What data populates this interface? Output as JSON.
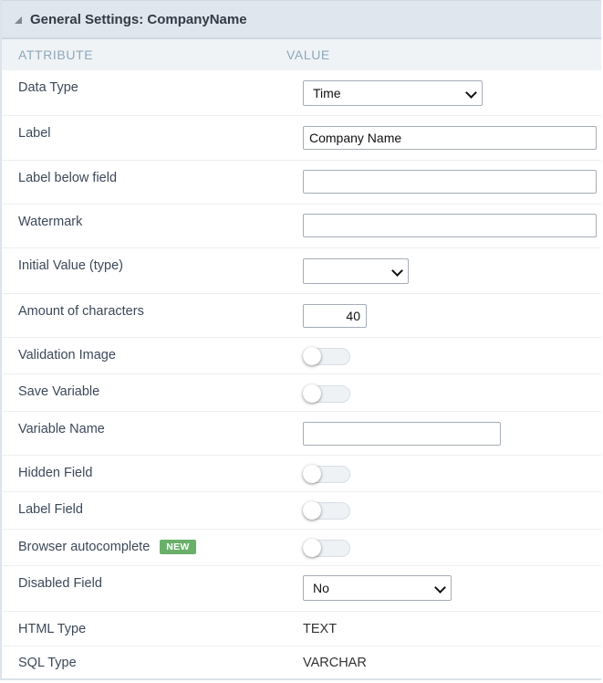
{
  "header": {
    "title": "General Settings: CompanyName"
  },
  "columns": {
    "attribute": "ATTRIBUTE",
    "value": "VALUE"
  },
  "rows": {
    "data_type": {
      "label": "Data Type",
      "value": "Time"
    },
    "label": {
      "label": "Label",
      "value": "Company Name"
    },
    "label_below": {
      "label": "Label below field",
      "value": ""
    },
    "watermark": {
      "label": "Watermark",
      "value": ""
    },
    "initial_value": {
      "label": "Initial Value (type)",
      "value": ""
    },
    "amount_chars": {
      "label": "Amount of characters",
      "value": "40"
    },
    "validation_image": {
      "label": "Validation Image",
      "on": false
    },
    "save_variable": {
      "label": "Save Variable",
      "on": false
    },
    "variable_name": {
      "label": "Variable Name",
      "value": ""
    },
    "hidden_field": {
      "label": "Hidden Field",
      "on": false
    },
    "label_field": {
      "label": "Label Field",
      "on": false
    },
    "browser_autocomplete": {
      "label": "Browser autocomplete",
      "badge": "NEW",
      "on": false
    },
    "disabled_field": {
      "label": "Disabled Field",
      "value": "No"
    },
    "html_type": {
      "label": "HTML Type",
      "value": "TEXT"
    },
    "sql_type": {
      "label": "SQL Type",
      "value": "VARCHAR"
    }
  },
  "colors": {
    "header_bg": "#dfe6ee",
    "colhead_bg": "#eff3f6",
    "badge_new": "#6ab06a"
  }
}
